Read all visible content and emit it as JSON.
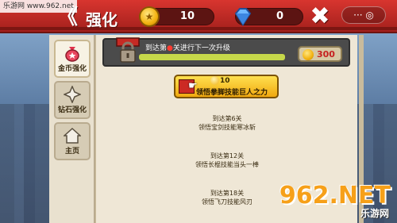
{
  "site_badge": "乐游网 www.962.net",
  "header": {
    "back_label": "《",
    "title": "强化",
    "gold_value": "10",
    "diamond_value": "0",
    "close_label": "✖",
    "sys_menu": "··· ◎"
  },
  "sidebar": {
    "items": [
      {
        "label": "金币强化",
        "icon": "money-bag-icon"
      },
      {
        "label": "钻石强化",
        "icon": "diamond-star-icon"
      },
      {
        "label": "主页",
        "icon": "home-icon"
      }
    ]
  },
  "progress": {
    "text_before": "到达第",
    "text_after": "关进行下一次升级",
    "fill_fraction": 1.0,
    "cost": "300"
  },
  "upgrade": {
    "cost": "10",
    "label": "领悟拳脚技能巨人之力"
  },
  "milestones": [
    {
      "level": "到达第6关",
      "skill": "领悟宝剑技能寒冰斩"
    },
    {
      "level": "到达第12关",
      "skill": "领悟长棍技能当头一棒"
    },
    {
      "level": "到达第18关",
      "skill": "领悟飞刀技能风刃"
    }
  ],
  "watermark": {
    "big": "962.NET",
    "small": "乐游网"
  },
  "colors": {
    "header_red": "#c72a25",
    "panel_cream": "#efe7d6",
    "gold": "#f2b210",
    "cost_red": "#c62020",
    "progress_green": "#c6d84a"
  }
}
